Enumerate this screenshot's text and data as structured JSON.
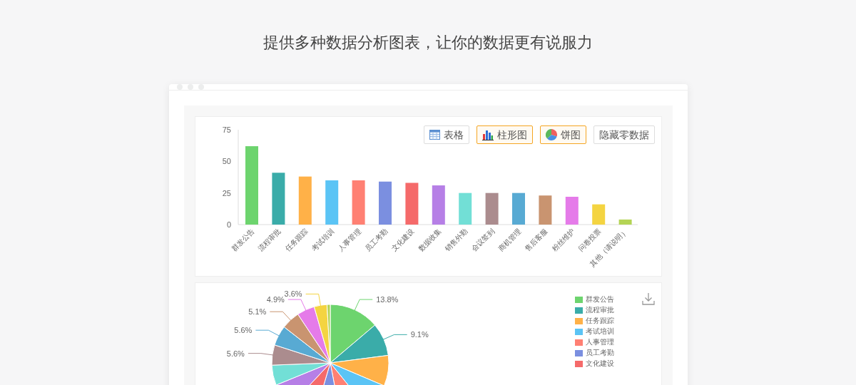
{
  "heading": "提供多种数据分析图表，让你的数据更有说服力",
  "view_buttons": [
    {
      "kind": "table",
      "label": "表格",
      "selected": false
    },
    {
      "kind": "bar",
      "label": "柱形图",
      "selected": true
    },
    {
      "kind": "pie",
      "label": "饼图",
      "selected": true
    },
    {
      "kind": "plain",
      "label": "隐藏零数据",
      "selected": false
    }
  ],
  "bar_chart": {
    "chart_data": {
      "type": "bar",
      "categories": [
        "群发公告",
        "流程审批",
        "任务跟踪",
        "考试培训",
        "人事管理",
        "员工考勤",
        "文化建设",
        "数据收集",
        "销售外勤",
        "会议签到",
        "商机管理",
        "售后客服",
        "粉丝维护",
        "问卷投票",
        "其他（请说明）"
      ],
      "values": [
        62,
        41,
        38,
        35,
        35,
        34,
        33,
        31,
        25,
        25,
        25,
        23,
        22,
        16,
        4
      ],
      "colors": [
        "#6dd46e",
        "#3aaca9",
        "#ffb148",
        "#5bc4f5",
        "#ff8073",
        "#7b8fe0",
        "#f56a6a",
        "#b67fe6",
        "#72dfd6",
        "#ab8c8e",
        "#58aad3",
        "#c99470",
        "#e57be9",
        "#f4d441",
        "#b4d455"
      ],
      "ylim": [
        0,
        75
      ],
      "yticks": [
        0,
        25,
        50,
        75
      ]
    }
  },
  "pie_chart": {
    "chart_data": {
      "type": "pie",
      "values": [
        13.81,
        9.13,
        8.46,
        7.8,
        7.8,
        7.57,
        7.35,
        6.9,
        5.57,
        5.57,
        5.57,
        5.12,
        4.9,
        3.56,
        0.89
      ],
      "colors": [
        "#6dd46e",
        "#3aaca9",
        "#ffb148",
        "#5bc4f5",
        "#ff8073",
        "#7b8fe0",
        "#f56a6a",
        "#b67fe6",
        "#72dfd6",
        "#ab8c8e",
        "#58aad3",
        "#c99470",
        "#e57be9",
        "#f4d441",
        "#b4d455"
      ],
      "value_labels": [
        "13.8%",
        "9.1%",
        null,
        null,
        null,
        null,
        null,
        null,
        null,
        "5.6%",
        "5.6%",
        "5.1%",
        "4.9%",
        "3.6%",
        null
      ]
    },
    "legend": [
      {
        "label": "群发公告",
        "color": "#6dd46e"
      },
      {
        "label": "流程审批",
        "color": "#3aaca9"
      },
      {
        "label": "任务跟踪",
        "color": "#ffb148"
      },
      {
        "label": "考试培训",
        "color": "#5bc4f5"
      },
      {
        "label": "人事管理",
        "color": "#ff8073"
      },
      {
        "label": "员工考勤",
        "color": "#7b8fe0"
      },
      {
        "label": "文化建设",
        "color": "#f56a6a"
      }
    ]
  }
}
